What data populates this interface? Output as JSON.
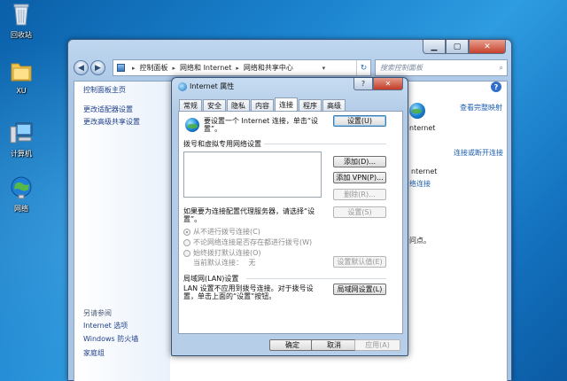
{
  "desktop": {
    "icons": [
      {
        "label": "回收站",
        "icon": "recycle-bin-icon"
      },
      {
        "label": "XU",
        "icon": "user-folder-icon"
      },
      {
        "label": "计算机",
        "icon": "computer-icon"
      },
      {
        "label": "网络",
        "icon": "network-icon"
      }
    ]
  },
  "explorer": {
    "breadcrumb": [
      "控制面板",
      "网络和 Internet",
      "网络和共享中心"
    ],
    "search_placeholder": "搜索控制面板",
    "sidebar_top": [
      "控制面板主页",
      "更改适配器设置",
      "更改高级共享设置"
    ],
    "see_also_title": "另请参阅",
    "see_also": [
      "Internet 选项",
      "Windows 防火墙",
      "家庭组"
    ],
    "right": {
      "view_full_map": "查看完整映射",
      "internet_label_1": "nternet",
      "connect_disconnect": "连接或断开连接",
      "internet_label_2": "nternet",
      "connection_fragment": "络连接",
      "access_point_fragment": "问点。"
    }
  },
  "dialog": {
    "title": "Internet 属性",
    "help_glyph": "?",
    "close_glyph": "✕",
    "tabs": [
      "常规",
      "安全",
      "隐私",
      "内容",
      "连接",
      "程序",
      "高级"
    ],
    "active_tab": "连接",
    "setup_text_line1": "要设置一个 Internet 连接，单击“设",
    "setup_text_line2": "置”。",
    "setup_button": "设置(U)",
    "dialup_group_title": "拨号和虚拟专用网络设置",
    "add_button": "添加(D)...",
    "add_vpn_button": "添加 VPN(P)...",
    "delete_button": "删除(R)...",
    "settings_button": "设置(S)",
    "proxy_text_line1": "如果要为连接配置代理服务器，请选择“设",
    "proxy_text_line2": "置”。",
    "radio_never": "从不进行拨号连接(C)",
    "radio_when_none": "不论网络连接是否存在都进行拨号(W)",
    "radio_always": "始终拨打默认连接(O)",
    "current_default_label": "当前默认连接：",
    "current_default_value": "无",
    "set_default_button": "设置默认值(E)",
    "lan_group_title": "局域网(LAN)设置",
    "lan_text_line1": "LAN 设置不应用到拨号连接。对于拨号设",
    "lan_text_line2": "置，单击上面的“设置”按钮。",
    "lan_button": "局域网设置(L)",
    "ok_button": "确定",
    "cancel_button": "取消",
    "apply_button": "应用(A)"
  }
}
